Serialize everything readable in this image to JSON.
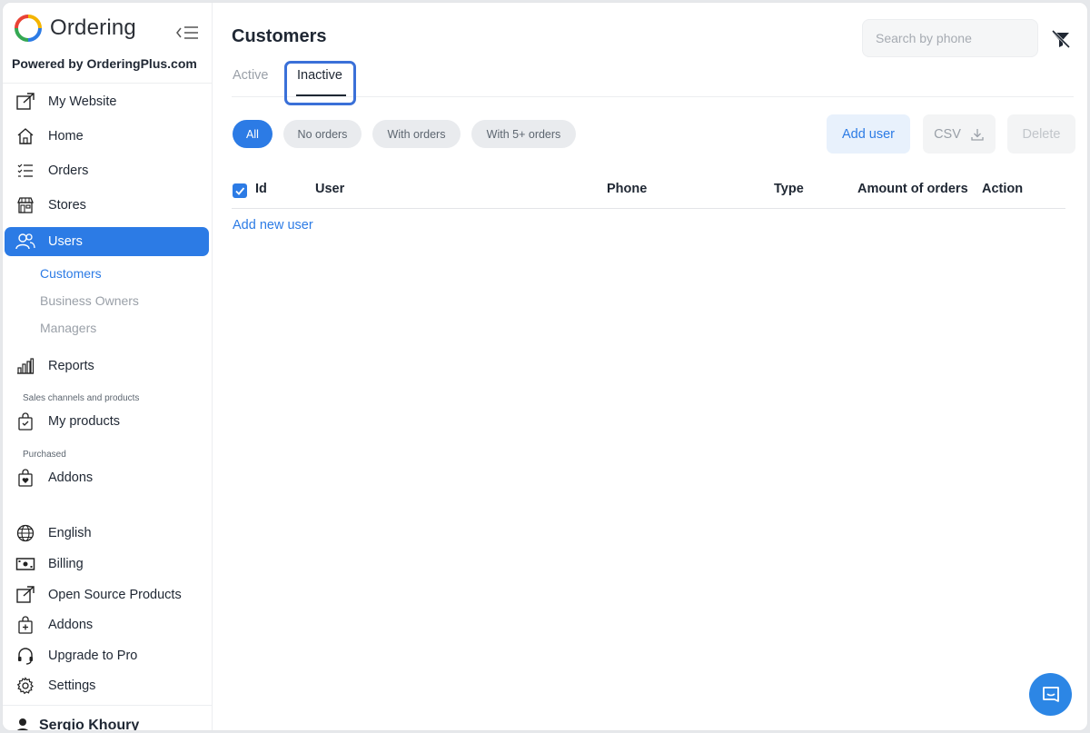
{
  "brand": {
    "name": "Ordering",
    "powered_by": "Powered by OrderingPlus.com"
  },
  "sidebar": {
    "items": [
      {
        "label": "My Website",
        "icon": "external-link-icon"
      },
      {
        "label": "Home",
        "icon": "home-icon"
      },
      {
        "label": "Orders",
        "icon": "list-check-icon"
      },
      {
        "label": "Stores",
        "icon": "shop-icon"
      },
      {
        "label": "Users",
        "icon": "people-icon",
        "active": true
      }
    ],
    "users_submenu": [
      "Customers",
      "Business Owners",
      "Managers"
    ],
    "reports": {
      "label": "Reports",
      "icon": "bar-chart-icon"
    },
    "section_sales": "Sales channels and products",
    "my_products": {
      "label": "My products",
      "icon": "bag-check-icon"
    },
    "section_purchased": "Purchased",
    "addons_top": {
      "label": "Addons",
      "icon": "bag-heart-icon"
    },
    "bottom_items": [
      {
        "label": "English",
        "icon": "globe-icon"
      },
      {
        "label": "Billing",
        "icon": "cash-icon"
      },
      {
        "label": "Open Source Products",
        "icon": "external-link-icon"
      },
      {
        "label": "Addons",
        "icon": "bag-plus-icon"
      },
      {
        "label": "Upgrade to Pro",
        "icon": "headset-icon"
      },
      {
        "label": "Settings",
        "icon": "gear-icon"
      }
    ],
    "user_name": "Sergio Khoury"
  },
  "main": {
    "title": "Customers",
    "search_placeholder": "Search by phone",
    "tabs": [
      "Active",
      "Inactive"
    ],
    "active_tab": "Inactive",
    "filters": [
      "All",
      "No orders",
      "With orders",
      "With 5+ orders"
    ],
    "active_filter": "All",
    "buttons": {
      "add_user": "Add user",
      "csv": "CSV",
      "delete": "Delete"
    },
    "columns": [
      "Id",
      "User",
      "Phone",
      "Type",
      "Amount of orders",
      "Action"
    ],
    "add_new_user": "Add new user"
  },
  "colors": {
    "accent": "#2c7be5",
    "highlight": "#3a70d8"
  }
}
